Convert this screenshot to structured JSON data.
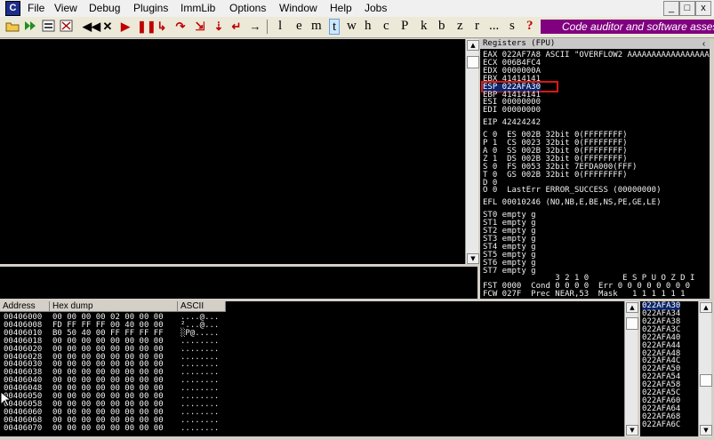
{
  "app": {
    "icon_letter": "C"
  },
  "menu": [
    "File",
    "View",
    "Debug",
    "Plugins",
    "ImmLib",
    "Options",
    "Window",
    "Help",
    "Jobs"
  ],
  "window_buttons": [
    "_",
    "□",
    "x"
  ],
  "toolbar": {
    "letters": [
      "l",
      "e",
      "m",
      "t",
      "w",
      "h",
      "c",
      "P",
      "k",
      "b",
      "z",
      "r",
      "...",
      "s",
      "?"
    ],
    "selected_letter": "t",
    "banner": "Code auditor and software assessment specialist"
  },
  "registers": {
    "title": "Registers (FPU)",
    "lines": [
      "EAX 022AF7A8 ASCII \"OVERFLOW2 AAAAAAAAAAAAAAAAA",
      "ECX 006B4FC4",
      "EDX 0000000A",
      "EBX 41414141",
      "ESP 022AFA30",
      "EBP 41414141",
      "ESI 00000000",
      "EDI 00000000",
      "",
      "EIP 42424242",
      "",
      "C 0  ES 002B 32bit 0(FFFFFFFF)",
      "P 1  CS 0023 32bit 0(FFFFFFFF)",
      "A 0  SS 002B 32bit 0(FFFFFFFF)",
      "Z 1  DS 002B 32bit 0(FFFFFFFF)",
      "S 0  FS 0053 32bit 7EFDA000(FFF)",
      "T 0  GS 002B 32bit 0(FFFFFFFF)",
      "D 0",
      "O 0  LastErr ERROR_SUCCESS (00000000)",
      "",
      "EFL 00010246 (NO,NB,E,BE,NS,PE,GE,LE)",
      "",
      "ST0 empty g",
      "ST1 empty g",
      "ST2 empty g",
      "ST3 empty g",
      "ST4 empty g",
      "ST5 empty g",
      "ST6 empty g",
      "ST7 empty g",
      "               3 2 1 0       E S P U O Z D I",
      "FST 0000  Cond 0 0 0 0  Err 0 0 0 0 0 0 0 0",
      "FCW 027F  Prec NEAR,53  Mask   1 1 1 1 1 1"
    ],
    "highlight": "ESP 022AFA30"
  },
  "dump": {
    "columns": {
      "address": "Address",
      "hex": "Hex dump",
      "ascii": "ASCII"
    },
    "rows": [
      {
        "addr": "00406000",
        "hex": "00 00 00 00 02 00 00 00",
        "ascii": "....@..."
      },
      {
        "addr": "00406008",
        "hex": "FD FF FF FF 00 40 00 00",
        "ascii": "²...@..."
      },
      {
        "addr": "00406010",
        "hex": "B0 50 40 00 FF FF FF FF",
        "ascii": "░P@....."
      },
      {
        "addr": "00406018",
        "hex": "00 00 00 00 00 00 00 00",
        "ascii": "........"
      },
      {
        "addr": "00406020",
        "hex": "00 00 00 00 00 00 00 00",
        "ascii": "........"
      },
      {
        "addr": "00406028",
        "hex": "00 00 00 00 00 00 00 00",
        "ascii": "........"
      },
      {
        "addr": "00406030",
        "hex": "00 00 00 00 00 00 00 00",
        "ascii": "........"
      },
      {
        "addr": "00406038",
        "hex": "00 00 00 00 00 00 00 00",
        "ascii": "........"
      },
      {
        "addr": "00406040",
        "hex": "00 00 00 00 00 00 00 00",
        "ascii": "........"
      },
      {
        "addr": "00406048",
        "hex": "00 00 00 00 00 00 00 00",
        "ascii": "........"
      },
      {
        "addr": "00406050",
        "hex": "00 00 00 00 00 00 00 00",
        "ascii": "........"
      },
      {
        "addr": "00406058",
        "hex": "00 00 00 00 00 00 00 00",
        "ascii": "........"
      },
      {
        "addr": "00406060",
        "hex": "00 00 00 00 00 00 00 00",
        "ascii": "........"
      },
      {
        "addr": "00406068",
        "hex": "00 00 00 00 00 00 00 00",
        "ascii": "........"
      },
      {
        "addr": "00406070",
        "hex": "00 00 00 00 00 00 00 00",
        "ascii": "........"
      }
    ]
  },
  "stack": {
    "selected": "022AFA30",
    "addresses": [
      "022AFA34",
      "022AFA38",
      "022AFA3C",
      "022AFA40",
      "022AFA44",
      "022AFA48",
      "022AFA4C",
      "022AFA50",
      "022AFA54",
      "022AFA58",
      "022AFA5C",
      "022AFA60",
      "022AFA64",
      "022AFA68",
      "022AFA6C"
    ]
  },
  "colors": {
    "banner": "#800080",
    "pane_bg": "#000000",
    "esp_box": "#d81818",
    "stack_select": "#0a246a"
  }
}
